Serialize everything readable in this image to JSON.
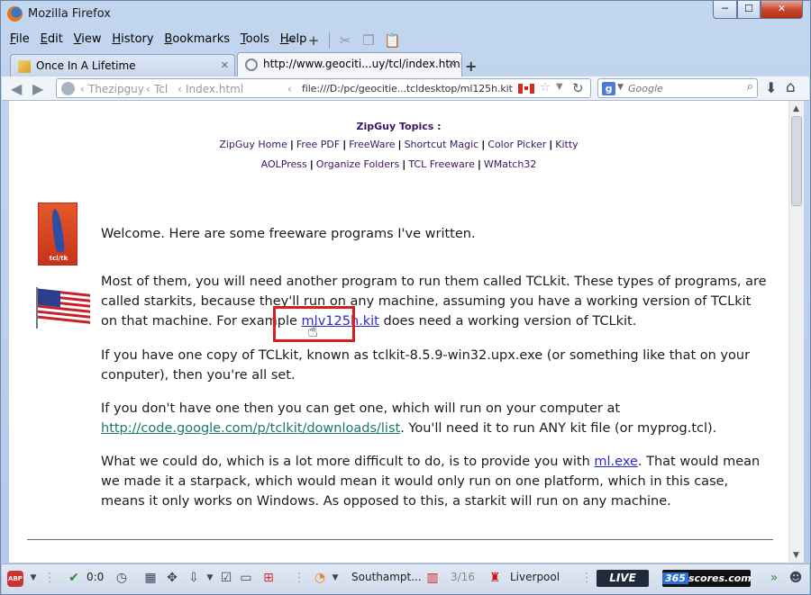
{
  "window": {
    "title": "Mozilla Firefox",
    "minimize": "─",
    "maximize": "☐",
    "close": "✕"
  },
  "menubar": {
    "items": [
      {
        "key": "F",
        "rest": "ile"
      },
      {
        "key": "E",
        "rest": "dit"
      },
      {
        "key": "V",
        "rest": "iew"
      },
      {
        "key": "H",
        "rest": "istory"
      },
      {
        "key": "B",
        "rest": "ookmarks"
      },
      {
        "key": "T",
        "rest": "ools"
      },
      {
        "key": "H",
        "rest": "elp"
      }
    ]
  },
  "tabs": [
    {
      "title": "Once In A Lifetime",
      "close": "✕"
    },
    {
      "title": "http://www.geociti...uy/tcl/index.html",
      "close": "✕"
    }
  ],
  "tab_new": "+",
  "navbar": {
    "back": "◀",
    "forward": "▶",
    "crumbs": [
      "Thezipguy",
      "Tcl",
      "Index.html"
    ],
    "url": "file:///D:/pc/geocitie...tcldesktop/ml125h.kit",
    "search_engine": "g",
    "search_placeholder": "Google"
  },
  "page": {
    "topics_title": "ZipGuy Topics :",
    "topics_row1": [
      "ZipGuy Home",
      "Free PDF",
      "FreeWare",
      "Shortcut Magic",
      "Color Picker",
      "Kitty"
    ],
    "topics_row2": [
      "AOLPress",
      "Organize Folders",
      "TCL Freeware",
      "WMatch32"
    ],
    "logo_label": "tcl/tk",
    "welcome": "Welcome. Here are some freeware programs I've written.",
    "most_1": "Most of them, you will need another program to run them called TCLkit.  These types of programs, are called starkits, because they'll run on any machine, assuming you have a working version of TCLkit on that machine.  For example ",
    "most_link": "mlv125h.kit",
    "most_2": " does need a working version of TCLkit.",
    "one": "If you have one copy of TCLkit, known as tclkit-8.5.9-win32.upx.exe (or something like that on your conputer), then you're all set.",
    "dont_1": "If you don't have one then you can get one, which will run on your computer at ",
    "dont_link": "http://code.google.com/p/tclkit/downloads/list",
    "dont_2": ". You'll need it to run ANY kit file (or myprog.tcl).",
    "what_1": "What we could do, which is a lot more difficult to do, is to provide you with ",
    "what_link": "ml.exe",
    "what_2": ".  That would mean we made it a starpack, which would mean it would only run on one platform, which in this case, means it only works on Windows.  As opposed to this, a starkit will run on any machine."
  },
  "addonbar": {
    "abp": "ABP",
    "counter": "0:0",
    "feed_team": "Southampt...",
    "score": "3/16",
    "team2": "Liverpool",
    "live": "LIVE",
    "scores_num": "365",
    "scores_word": "scores.com"
  },
  "colors": {
    "accent_red": "#d71f1f",
    "topic_purple": "#3d1560",
    "link_blue": "#2a2ad0",
    "link_teal": "#1a7a6a"
  }
}
